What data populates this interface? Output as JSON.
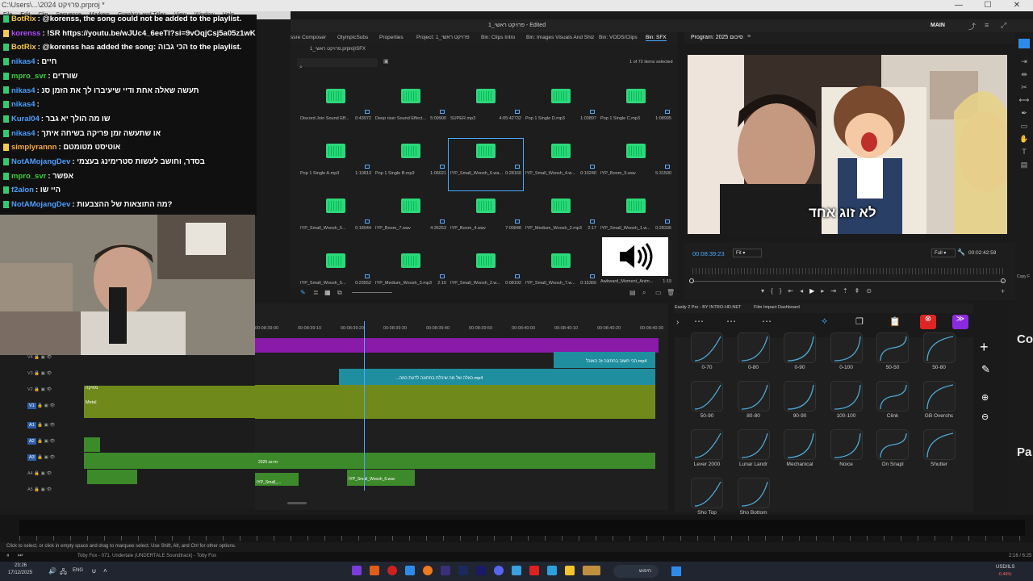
{
  "window": {
    "title": "1_פרויקט ראשי - Edited",
    "path": "C:\\Users\\...\\2024 פרויקט.prproj *",
    "workspace": "MAIN"
  },
  "menu": [
    "File",
    "Edit",
    "Clip",
    "Sequence",
    "Markers",
    "Graphics and Titles",
    "View",
    "Window",
    "Help"
  ],
  "chat": [
    {
      "user": "BotRix",
      "color": "#f7c948",
      "text": ": @korenss, the song could not be added to the playlist."
    },
    {
      "user": "korenss",
      "color": "#b04aff",
      "text": ": !SR https://youtu.be/wJUc4_6eeTI?si=9vOqjCsj5a05z1wK"
    },
    {
      "user": "BotRix",
      "color": "#f7c948",
      "text": ": @korenss has added the song: הכי גבוה to the playlist."
    },
    {
      "user": "nikas4",
      "color": "#4a9fff",
      "text": ": חיים"
    },
    {
      "user": "mpro_svr",
      "color": "#3ecf3e",
      "text": ": שורדים"
    },
    {
      "user": "nikas4",
      "color": "#4a9fff",
      "text": ": תעשה שאלה אחת ודיי שיעיברו לך את הזמן סנ"
    },
    {
      "user": "nikas4",
      "color": "#4a9fff",
      "text": ": "
    },
    {
      "user": "Kural04",
      "color": "#4a9fff",
      "text": ": שו מה הולך יא גבר"
    },
    {
      "user": "nikas4",
      "color": "#4a9fff",
      "text": ": או שתעשה זמן פריקה בשיחה איתך"
    },
    {
      "user": "simplyrannn",
      "color": "#f7a935",
      "text": ": אוטיסט מטומטם"
    },
    {
      "user": "NotAMojangDev",
      "color": "#4a9fff",
      "text": ": בסדר, וחושב לעשות סטרימינג בעצמי"
    },
    {
      "user": "mpro_svr",
      "color": "#3ecf3e",
      "text": ": אפשר"
    },
    {
      "user": "f2alon",
      "color": "#4a9fff",
      "text": ": היי שו"
    },
    {
      "user": "NotAMojangDev",
      "color": "#4a9fff",
      "text": ": מה התוצאות של ההצבעות?"
    }
  ],
  "project_tabs": [
    "ssre Composer",
    "OlympicSubs",
    "Properties",
    "Project: 1_פרויקט ראשי",
    "Bin: Clips Intro",
    "Bin: Images Visuals And Shiz",
    "Bin: VODS/Clips",
    "Bin: SFX"
  ],
  "project": {
    "bin_path": "1_פרויקט ראשי.prproj\\SFX",
    "selection": "1 of 72 items selected",
    "items": [
      {
        "name": "Discord Join Sound Eff...",
        "duration": "0:43972"
      },
      {
        "name": "Deep riser Sound Effect...",
        "duration": "5:09900"
      },
      {
        "name": "SUPER.mp3",
        "duration": "4:05:42732"
      },
      {
        "name": "Pop 1 Single D.mp3",
        "duration": "1:03897"
      },
      {
        "name": "Pop 1 Single C.mp3",
        "duration": "1:08995"
      },
      {
        "name": "Pop 1 Single A.mp3",
        "duration": "1:10813"
      },
      {
        "name": "Pop 1 Single B.mp3",
        "duration": "1:06021"
      },
      {
        "name": "IYP_Small_Woosh_6.wa...",
        "duration": "0:28160"
      },
      {
        "name": "IYP_Small_Woosh_4.w...",
        "duration": "0:10240"
      },
      {
        "name": "IYP_Boom_5.wav",
        "duration": "5:31500"
      },
      {
        "name": "IYP_Small_Woosh_5...",
        "duration": "0:18944"
      },
      {
        "name": "IYP_Boom_7.wav",
        "duration": "4:35253"
      },
      {
        "name": "IYP_Boom_4.wav",
        "duration": "7:00848"
      },
      {
        "name": "IYP_Medium_Woosh_2.mp3",
        "duration": "2:17"
      },
      {
        "name": "IYP_Small_Woosh_1.w...",
        "duration": "0:28336"
      },
      {
        "name": "IYP_Small_Woosh_5...",
        "duration": "0:23552"
      },
      {
        "name": "IYP_Medium_Woosh_3.mp3",
        "duration": "2:10"
      },
      {
        "name": "IYP_Small_Woosh_2.w...",
        "duration": "0:08192"
      },
      {
        "name": "IYP_Small_Woosh_7.w...",
        "duration": "0:15360"
      },
      {
        "name": "Awkward_Moment_Anim...",
        "duration": "1:19"
      }
    ]
  },
  "program": {
    "title": "Program: 2025 סיכום",
    "timecode": "00:08:39:23",
    "fit": "Fit",
    "quality": "Full",
    "duration": "00:02:42:59",
    "caption": "לא זוג אחד"
  },
  "timeline": {
    "ruler": [
      "00:08:39:00",
      "00:08:39:10",
      "00:08:39:20",
      "00:08:39:30",
      "00:08:39:40",
      "00:08:39:50",
      "00:08:40:00",
      "00:08:40:10",
      "00:08:40:20",
      "00:08:40:30"
    ],
    "clips": {
      "v3_clip": "הכי חשוב בחתונה זה האוכל.mp4",
      "v2_clip": "...כאלה של מה שיכלת בחתונה לדעת כמה.mp4",
      "v1_label": "Metal",
      "v1b_label": "מוזיקה",
      "a2_clip": "2025 סיכום",
      "a4_clip": "IYP_Small_...",
      "a4b_clip": "IYP_Small_Woosh_6.wav"
    },
    "tracks": [
      "V4",
      "V3",
      "V2",
      "V1",
      "A1",
      "A2",
      "A3",
      "A4",
      "A5"
    ]
  },
  "effects": {
    "tabs": [
      "Easily 2 Pro - BY INTRO-HD.NET",
      "Film Impact Dashboard"
    ],
    "presets": [
      "0-70",
      "0-80",
      "0-90",
      "0-100",
      "50-50",
      "50-80",
      "50-90",
      "80-80",
      "90-90",
      "100-100",
      "Clink",
      "GB Overshc",
      "Lever 2000",
      "Lunar Landr",
      "Mechanical",
      "Noice",
      "On Snapl",
      "Shutter",
      "Sho Top",
      "Sho Bottom"
    ]
  },
  "right_edge": {
    "top_text": "Co",
    "bottom_text": "Pa",
    "copy_label": "Copy F"
  },
  "statusbar": {
    "hint": "Click to select, or click in empty space and drag to marquee select. Use Shift, Alt, and Ctrl for other options.",
    "now_playing": "Toby Fox - 071. Undertale (UNDERTALE Soundtrack) - Toby Fox",
    "track_time": "2:16 / 6:25"
  },
  "taskbar": {
    "time": "23:26",
    "date": "17/12/2025",
    "lang": "ENG",
    "search": "חיפוש",
    "stock": "USD/ILS",
    "stock_change": "-0.46%"
  },
  "colors": {
    "purple_track": "#8a1aa8",
    "teal_clip": "#1f8fa0",
    "olive_clip": "#6f8a1a",
    "audio_green": "#3d8a2a",
    "accent_blue": "#2d8ceb"
  }
}
